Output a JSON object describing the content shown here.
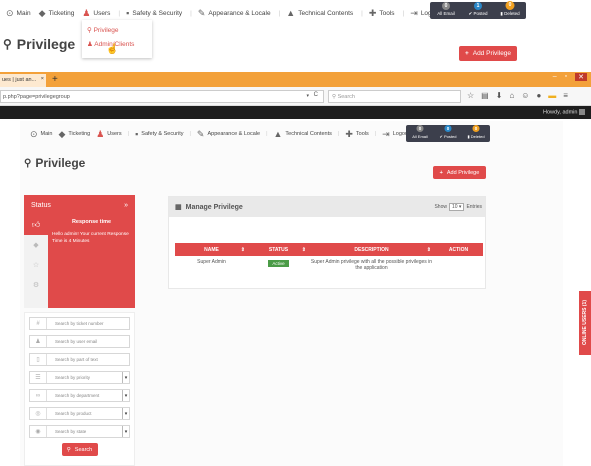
{
  "top_nav": {
    "items": [
      {
        "label": "Main",
        "icon": "home-icon"
      },
      {
        "label": "Ticketing",
        "icon": "tag-icon"
      },
      {
        "label": "Users",
        "icon": "users-icon"
      },
      {
        "label": "Safety & Security",
        "icon": "lock-icon"
      },
      {
        "label": "Appearance & Locale",
        "icon": "brush-icon"
      },
      {
        "label": "Technical Contents",
        "icon": "graduation-icon"
      },
      {
        "label": "Tools",
        "icon": "wrench-icon"
      },
      {
        "label": "Logout",
        "icon": "logout-icon"
      }
    ],
    "notifications": [
      {
        "label": "All Email",
        "count": "0"
      },
      {
        "label": "Posted",
        "count": "1"
      },
      {
        "label": "Deleted",
        "count": "0"
      }
    ]
  },
  "dropdown": {
    "items": [
      {
        "label": "Privilege"
      },
      {
        "label": "Admin/Clients"
      }
    ]
  },
  "top_page": {
    "title": "Privilege",
    "add_button": "Add Privilege"
  },
  "browser": {
    "tab_title": "ues | just an...",
    "tab_close": "×",
    "new_tab": "+",
    "url": "p.php?page=privilegegroup",
    "search_placeholder": "Search",
    "greeting": "Howdy, admin"
  },
  "inner_nav": {
    "items": [
      {
        "label": "Main"
      },
      {
        "label": "Ticketing"
      },
      {
        "label": "Users"
      },
      {
        "label": "Safety & Security"
      },
      {
        "label": "Appearance & Locale"
      },
      {
        "label": "Technical Contents"
      },
      {
        "label": "Tools"
      },
      {
        "label": "Logout"
      }
    ],
    "notifications": [
      {
        "label": "All Email",
        "count": "0"
      },
      {
        "label": "Posted",
        "count": "0"
      },
      {
        "label": "Deleted",
        "count": "0"
      }
    ]
  },
  "page": {
    "title": "Privilege",
    "add_button": "Add Privilege"
  },
  "status_panel": {
    "title": "Status",
    "toggle": "»",
    "section_title": "Response time",
    "text": "Hello admin! Your current Response Time is 4 Minutes"
  },
  "filters": [
    {
      "placeholder": "Search by ticket number",
      "type": "input"
    },
    {
      "placeholder": "Search by user email",
      "type": "input"
    },
    {
      "placeholder": "Search by part of text",
      "type": "input"
    },
    {
      "placeholder": "Search by priority",
      "type": "select"
    },
    {
      "placeholder": "Search by department",
      "type": "select"
    },
    {
      "placeholder": "Search by product",
      "type": "select"
    },
    {
      "placeholder": "Search by state",
      "type": "select"
    }
  ],
  "search_button": "Search",
  "manage": {
    "title": "Manage Privilege",
    "show_label": "Show",
    "entries_value": "10",
    "entries_label": "Entries",
    "columns": [
      "NAME",
      "STATUS",
      "DESCRIPTION",
      "ACTION"
    ],
    "rows": [
      {
        "name": "Super Admin",
        "status": "Active",
        "description": "Super Admin privilege with all the possible privileges in the application",
        "action": ""
      }
    ]
  },
  "side_tab": "ONLINE USERS (1)",
  "colors": {
    "accent": "#e04a4a",
    "dark": "#3c3f4c",
    "active": "#4b9b47"
  }
}
